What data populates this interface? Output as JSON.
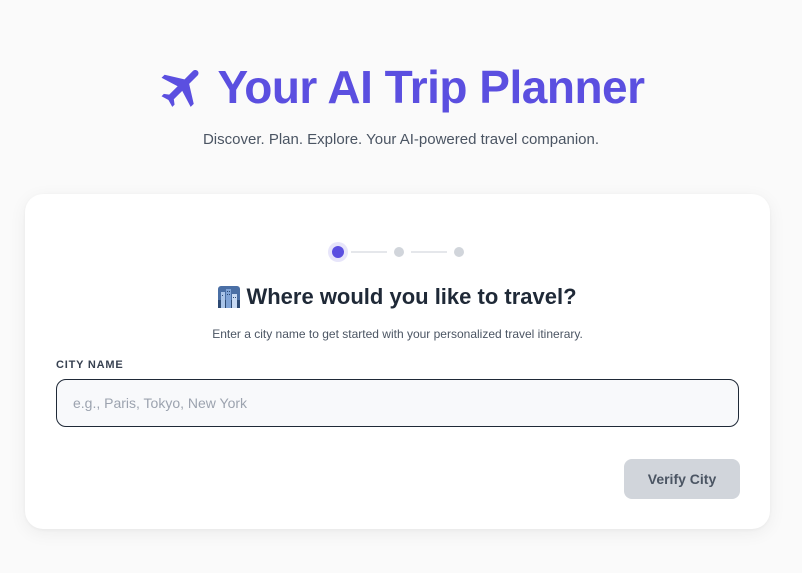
{
  "header": {
    "title": "Your AI Trip Planner",
    "icon": "airplane-icon",
    "subtitle": "Discover. Plan. Explore. Your AI-powered travel companion."
  },
  "colors": {
    "accent": "#5b4fe0",
    "muted_dot": "#d1d5db",
    "button_disabled": "#d1d5db"
  },
  "stepper": {
    "total_steps": 3,
    "active_step": 1
  },
  "card": {
    "heading_icon": "cityscape-icon",
    "heading": "Where would you like to travel?",
    "description": "Enter a city name to get started with your personalized travel itinerary.",
    "field_label": "CITY NAME",
    "input": {
      "value": "",
      "placeholder": "e.g., Paris, Tokyo, New York"
    },
    "verify_label": "Verify City"
  }
}
